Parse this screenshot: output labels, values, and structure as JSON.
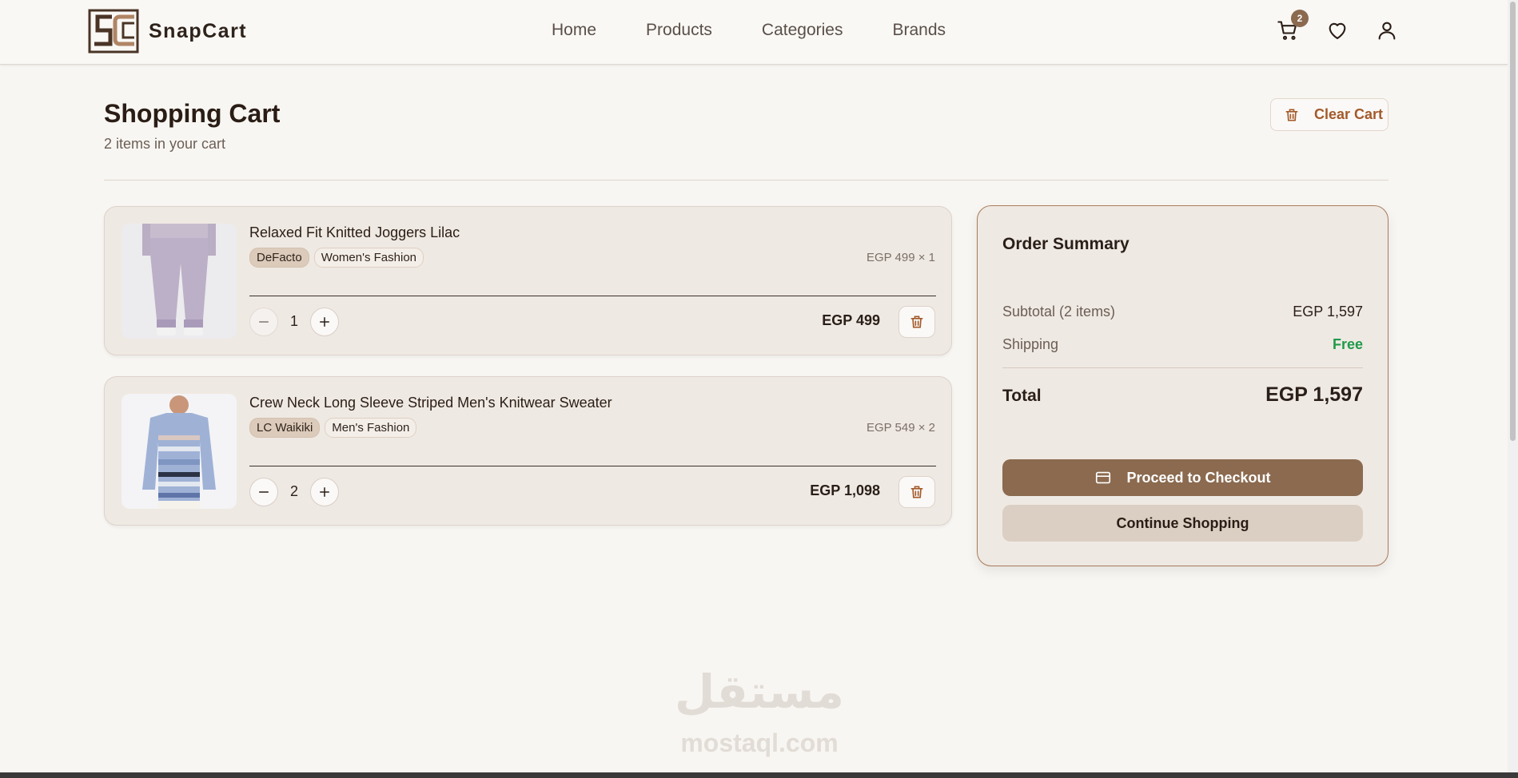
{
  "header": {
    "brand_name": "SnapCart",
    "nav": [
      "Home",
      "Products",
      "Categories",
      "Brands"
    ],
    "cart_count": "2",
    "icons": [
      "cart-icon",
      "heart-icon",
      "user-icon"
    ]
  },
  "page": {
    "title": "Shopping Cart",
    "subtitle": "2 items in your cart",
    "clear_cart_label": "Clear Cart"
  },
  "items": [
    {
      "name": "Relaxed Fit Knitted Joggers Lilac",
      "brand": "DeFacto",
      "category": "Women's Fashion",
      "unit_price": "EGP 499 × 1",
      "quantity": "1",
      "line_total": "EGP 499"
    },
    {
      "name": "Crew Neck Long Sleeve Striped Men's Knitwear Sweater",
      "brand": "LC Waikiki",
      "category": "Men's Fashion",
      "unit_price": "EGP 549 × 2",
      "quantity": "2",
      "line_total": "EGP 1,098"
    }
  ],
  "summary": {
    "title": "Order Summary",
    "subtotal_label": "Subtotal (2 items)",
    "subtotal_value": "EGP 1,597",
    "shipping_label": "Shipping",
    "shipping_value": "Free",
    "total_label": "Total",
    "total_value": "EGP 1,597",
    "checkout_label": "Proceed to Checkout",
    "continue_label": "Continue Shopping"
  },
  "watermark": {
    "arabic": "مستقل",
    "latin": "mostaql.com"
  },
  "colors": {
    "accent": "#8b6a4f",
    "danger": "#a35a2a",
    "free": "#1f9a4b",
    "background": "#f8f6f2"
  }
}
